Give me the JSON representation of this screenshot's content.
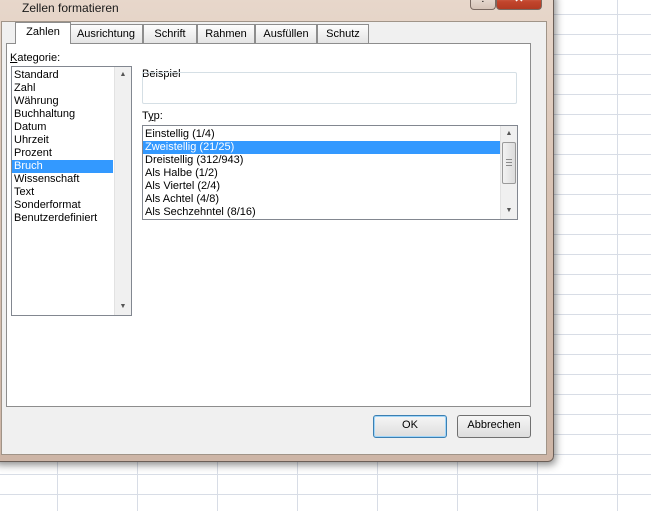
{
  "dialog": {
    "title": "Zellen formatieren",
    "help_label": "?",
    "close_label": "✕"
  },
  "tabs": [
    {
      "label": "Zahlen",
      "active": true
    },
    {
      "label": "Ausrichtung",
      "active": false
    },
    {
      "label": "Schrift",
      "active": false
    },
    {
      "label": "Rahmen",
      "active": false
    },
    {
      "label": "Ausfüllen",
      "active": false
    },
    {
      "label": "Schutz",
      "active": false
    }
  ],
  "kategorie": {
    "label_prefix": "K",
    "label_rest": "ategorie:",
    "selected": "Bruch",
    "items": [
      "Standard",
      "Zahl",
      "Währung",
      "Buchhaltung",
      "Datum",
      "Uhrzeit",
      "Prozent",
      "Bruch",
      "Wissenschaft",
      "Text",
      "Sonderformat",
      "Benutzerdefiniert"
    ]
  },
  "beispiel": {
    "label": "Beispiel",
    "value": ""
  },
  "typ": {
    "label_prefix": "T",
    "label_mid": "y",
    "label_rest": "p:",
    "selected": "Zweistellig (21/25)",
    "items": [
      "Einstellig (1/4)",
      "Zweistellig (21/25)",
      "Dreistellig (312/943)",
      "Als Halbe (1/2)",
      "Als Viertel (2/4)",
      "Als Achtel (4/8)",
      "Als Sechzehntel (8/16)"
    ]
  },
  "buttons": {
    "ok": "OK",
    "cancel": "Abbrechen"
  },
  "icons": {
    "scroll_up": "▲",
    "scroll_down": "▼"
  }
}
